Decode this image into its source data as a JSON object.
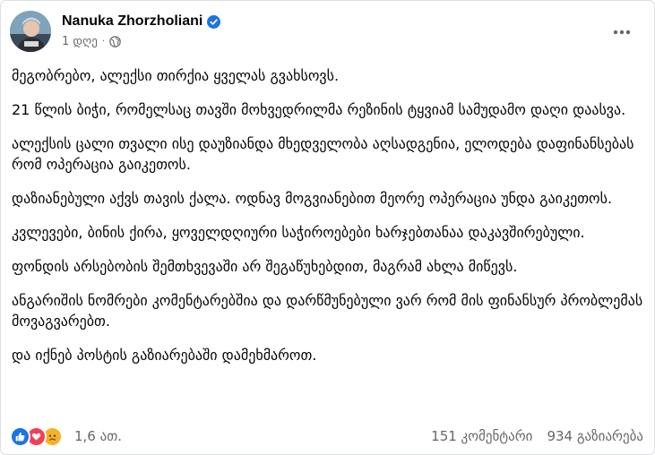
{
  "post": {
    "author": "Nanuka Zhorzholiani",
    "time": "1 დღე",
    "separator": "·",
    "paragraphs": [
      "მეგობრებო, ალექსი თირქია ყველას გვახსოვს.",
      "21 წლის ბიჭი, რომელსაც თავში მოხვედრილმა რეზინის ტყვიამ სამუდამო დაღი დაასვა.",
      "ალექსის ცალი თვალი ისე დაუზიანდა მხედველობა აღსადგენია, ელოდება დაფინანსებას რომ ოპერაცია გაიკეთოს.",
      "დაზიანებული აქვს თავის ქალა. ოდნავ მოგვიანებით მეორე ოპერაცია უნდა გაიკეთოს.",
      "კვლევები, ბინის ქირა, ყოველდღიური საჭიროებები ხარჯებთანაა დაკავშირებული.",
      "ფონდის არსებობის შემთხვევაში არ შეგაწუხებდით, მაგრამ ახლა მიწევს.",
      "ანგარიშის ნომრები კომენტარებშია და დარწმუნებული ვარ რომ მის ფინანსურ პრობლემას მოვაგვარებთ.",
      "და იქნებ პოსტის გაზიარებაში დამეხმაროთ."
    ]
  },
  "footer": {
    "reactions": [
      "like",
      "love",
      "sad"
    ],
    "reaction_count": "1,6 ათ.",
    "comments": "151 კომენტარი",
    "shares": "934 გაზიარება"
  },
  "colors": {
    "accent": "#1b74e4",
    "text_secondary": "#65676b",
    "love": "#f33e58",
    "sad": "#f7b125"
  }
}
